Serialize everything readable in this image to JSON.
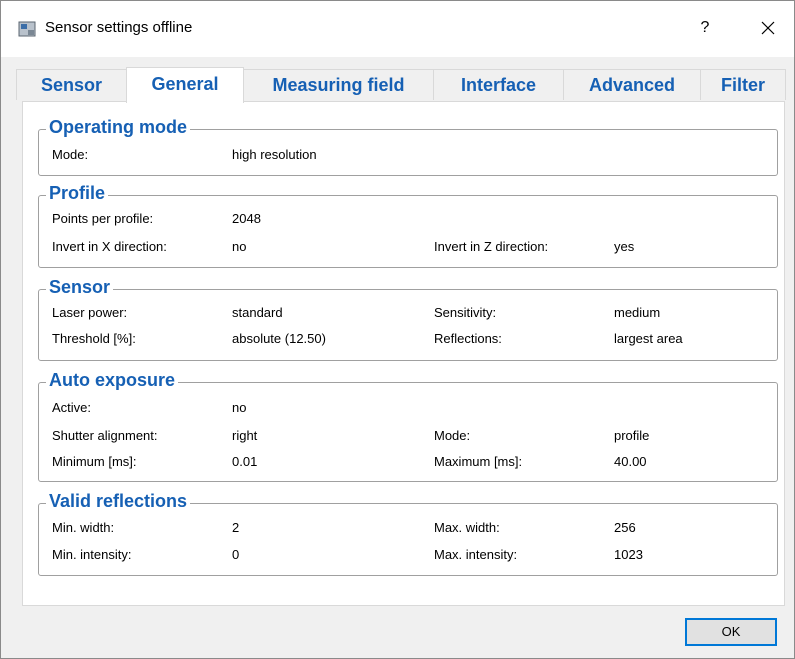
{
  "window": {
    "title": "Sensor settings offline",
    "help": "?"
  },
  "tabs": [
    "Sensor",
    "General",
    "Measuring field",
    "Interface",
    "Advanced",
    "Filter"
  ],
  "groups": {
    "operating_mode": {
      "title": "Operating mode",
      "rows": {
        "mode_label": "Mode:",
        "mode_value": "high resolution"
      }
    },
    "profile": {
      "title": "Profile",
      "points_label": "Points per profile:",
      "points_value": "2048",
      "invert_x_label": "Invert in X direction:",
      "invert_x_value": "no",
      "invert_z_label": "Invert in Z direction:",
      "invert_z_value": "yes"
    },
    "sensor": {
      "title": "Sensor",
      "laser_label": "Laser power:",
      "laser_value": "standard",
      "sensitivity_label": "Sensitivity:",
      "sensitivity_value": "medium",
      "threshold_label": "Threshold [%]:",
      "threshold_value": "absolute (12.50)",
      "reflections_label": "Reflections:",
      "reflections_value": "largest area"
    },
    "auto_exposure": {
      "title": "Auto exposure",
      "active_label": "Active:",
      "active_value": "no",
      "shutter_label": "Shutter alignment:",
      "shutter_value": "right",
      "mode_label": "Mode:",
      "mode_value": "profile",
      "min_label": "Minimum [ms]:",
      "min_value": "0.01",
      "max_label": "Maximum [ms]:",
      "max_value": "40.00"
    },
    "valid_reflections": {
      "title": "Valid reflections",
      "min_width_label": "Min. width:",
      "min_width_value": "2",
      "max_width_label": "Max. width:",
      "max_width_value": "256",
      "min_int_label": "Min. intensity:",
      "min_int_value": "0",
      "max_int_label": "Max. intensity:",
      "max_int_value": "1023"
    }
  },
  "buttons": {
    "ok": "OK"
  },
  "icons": {
    "app": "sensor-app-icon",
    "close": "close-icon"
  },
  "colors": {
    "accent": "#1660b4"
  }
}
